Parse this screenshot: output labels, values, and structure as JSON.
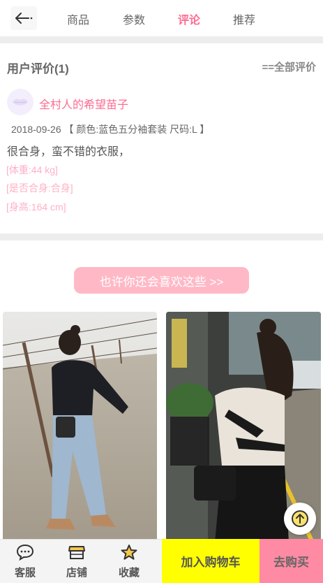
{
  "nav": {
    "tabs": [
      {
        "label": "商品"
      },
      {
        "label": "参数"
      },
      {
        "label": "评论"
      },
      {
        "label": "推荐"
      }
    ],
    "active_tab": "评论"
  },
  "reviews": {
    "header": "用户评价(1)",
    "all_link": "==全部评价",
    "items": [
      {
        "username": "全村人的希望苗子",
        "meta": "2018-09-26 【 颜色:蓝色五分袖套装 尺码:L 】",
        "content": "很合身，蛮不错的衣服，",
        "attrs": [
          "[体重:44 kg]",
          "[是否合身:合身]",
          "[身高:164 cm]"
        ]
      }
    ]
  },
  "recommend": {
    "button_label": "也许你还会喜欢这些 >>"
  },
  "bottom_bar": {
    "service_label": "客服",
    "store_label": "店铺",
    "favorite_label": "收藏",
    "cart_label": "加入购物车",
    "buy_label": "去购买"
  },
  "colors": {
    "accent": "#ff6b92",
    "cart": "#ffff00",
    "buy": "#ff8aa3",
    "recommend_button": "#ffb8c6"
  }
}
